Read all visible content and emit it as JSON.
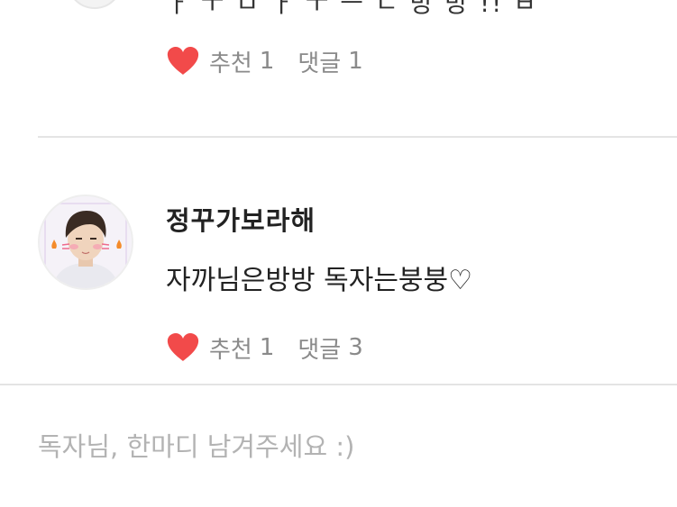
{
  "previous_comment": {
    "text": "ㅏ   ㅜ   ㅁ           ㅏ   ㅜ   ㅡ ㄴ 방 방 !! ㅂ",
    "recommend_label": "추천",
    "recommend_count": "1",
    "reply_label": "댓글",
    "reply_count": "1"
  },
  "comment": {
    "nickname": "정꾸가보라해",
    "text": "자까님은방방 독자는붕붕♡",
    "recommend_label": "추천",
    "recommend_count": "1",
    "reply_label": "댓글",
    "reply_count": "3"
  },
  "input": {
    "placeholder": "독자님, 한마디 남겨주세요 :)"
  },
  "colors": {
    "heart": "#f24a4a",
    "muted_text": "#8a8a8a",
    "divider": "#e4e4e4",
    "placeholder": "#b3b3b3"
  },
  "icons": {
    "like": "heart-icon",
    "avatar": "avatar"
  }
}
